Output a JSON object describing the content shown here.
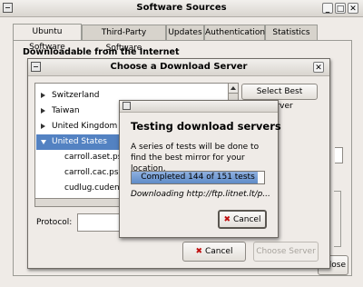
{
  "main_window": {
    "title": "Software Sources",
    "tabs": [
      "Ubuntu Software",
      "Third-Party Software",
      "Updates",
      "Authentication",
      "Statistics"
    ],
    "section_heading": "Downloadable from the Internet",
    "close_label_fragment": "lose"
  },
  "server_dialog": {
    "title": "Choose a Download Server",
    "countries": [
      {
        "name": "Switzerland",
        "expanded": false
      },
      {
        "name": "Taiwan",
        "expanded": false
      },
      {
        "name": "United Kingdom",
        "expanded": false
      },
      {
        "name": "United States",
        "expanded": true,
        "selected": true
      }
    ],
    "mirrors": [
      "carroll.aset.psu",
      "carroll.cac.psu.",
      "cudlug.cudenve"
    ],
    "select_best_label": "Select Best Server",
    "protocol_label": "Protocol:",
    "cancel_label": "Cancel",
    "choose_label": "Choose Server"
  },
  "test_dialog": {
    "heading": "Testing download servers",
    "description": "A series of tests will be done to find the best mirror for your location.",
    "progress_text": "Completed 144 of 151 tests",
    "progress_fraction": 0.954,
    "status_text": "Downloading http://ftp.litnet.lt/p...",
    "cancel_label": "Cancel"
  }
}
